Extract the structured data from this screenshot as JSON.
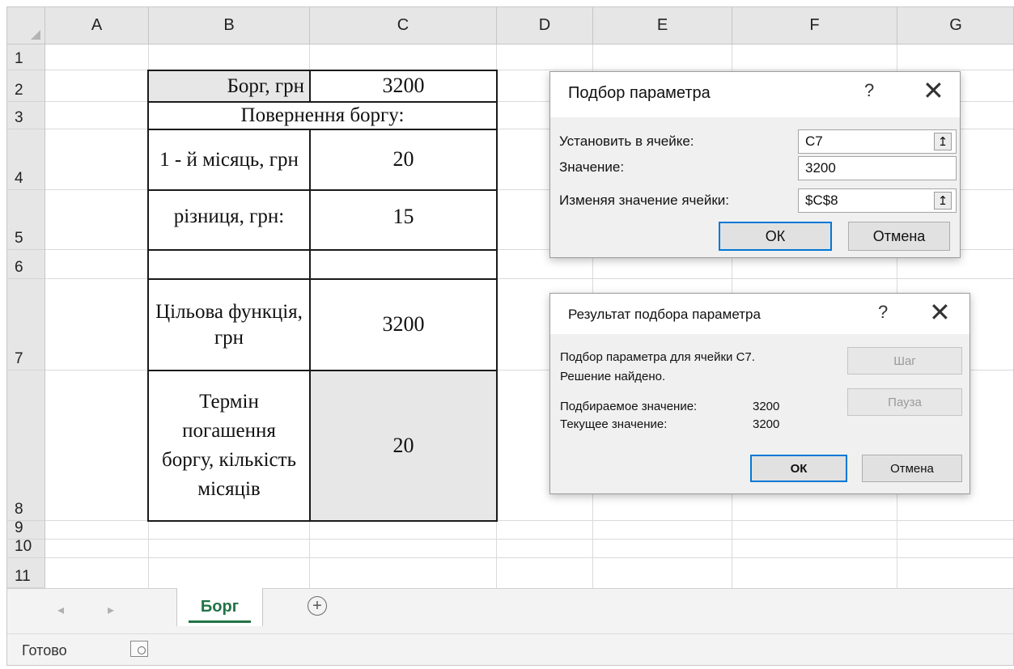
{
  "sheet": {
    "columns": [
      "A",
      "B",
      "C",
      "D",
      "E",
      "F",
      "G"
    ],
    "rows": [
      "1",
      "2",
      "3",
      "4",
      "5",
      "6",
      "7",
      "8",
      "9",
      "10",
      "11"
    ]
  },
  "table": {
    "b2": "Борг, грн",
    "c2": "3200",
    "b3": "Повернення боргу:",
    "b4": "1 - й місяць, грн",
    "c4": "20",
    "b5": "різниця, грн:",
    "c5": "15",
    "b7": "Цільова функція, грн",
    "c7": "3200",
    "b8": "Термін погашення боргу, кількість місяців",
    "c8": "20"
  },
  "goal_seek": {
    "title": "Подбор параметра",
    "help": "?",
    "close": "✕",
    "set_cell_label": "Установить в ячейке:",
    "set_cell_value": "C7",
    "to_value_label": "Значение:",
    "to_value": "3200",
    "changing_cell_label": "Изменяя значение ячейки:",
    "changing_cell_value": "$C$8",
    "ok": "ОК",
    "cancel": "Отмена"
  },
  "goal_seek_status": {
    "title": "Результат подбора параметра",
    "help": "?",
    "close": "✕",
    "message1": "Подбор параметра для ячейки C7.",
    "message2": "Решение найдено.",
    "target_label": "Подбираемое значение:",
    "target_value": "3200",
    "current_label": "Текущее значение:",
    "current_value": "3200",
    "step": "Шаг",
    "pause": "Пауза",
    "ok": "ОК",
    "cancel": "Отмена"
  },
  "tabs": {
    "prev": "◂",
    "next": "▸",
    "sheet_name": "Борг",
    "add": "+"
  },
  "status": {
    "ready": "Готово"
  },
  "icons": {
    "ref_collapse": "↥",
    "macro_record": "macro-record-icon"
  }
}
